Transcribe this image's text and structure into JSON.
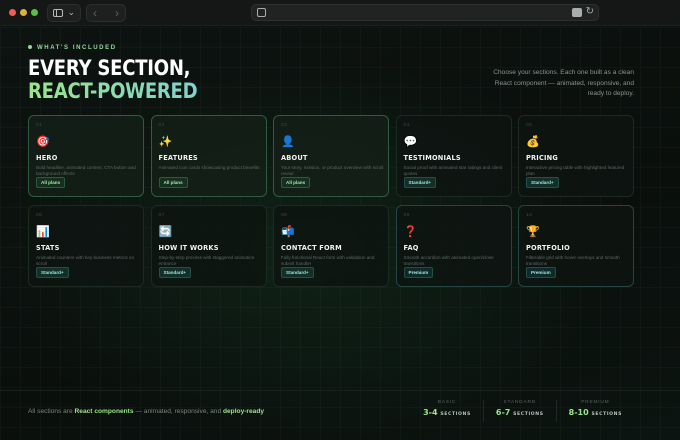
{
  "header": {
    "eyebrow": "WHAT'S INCLUDED",
    "title_line1": "EVERY SECTION,",
    "title_line2": "REACT-POWERED",
    "intro": "Choose your sections. Each one built as a clean React component — animated, responsive, and ready to deploy."
  },
  "sections": [
    {
      "num": "01",
      "icon": "🎯",
      "icon_name": "target-icon",
      "title": "HERO",
      "desc": "Bold headline, animated content, CTA button and background effects",
      "badge": "All plans",
      "tier": "free"
    },
    {
      "num": "02",
      "icon": "✨",
      "icon_name": "sparkles-icon",
      "title": "FEATURES",
      "desc": "Animated icon cards showcasing product benefits",
      "badge": "All plans",
      "tier": "free"
    },
    {
      "num": "03",
      "icon": "👤",
      "icon_name": "person-icon",
      "title": "ABOUT",
      "desc": "Your story, mission, or product overview with scroll reveal",
      "badge": "All plans",
      "tier": "free"
    },
    {
      "num": "04",
      "icon": "💬",
      "icon_name": "speech-bubble-icon",
      "title": "TESTIMONIALS",
      "desc": "Social proof with animated star ratings and client quotes",
      "badge": "Standard+",
      "tier": "std"
    },
    {
      "num": "05",
      "icon": "💰",
      "icon_name": "money-bag-icon",
      "title": "PRICING",
      "desc": "Interactive pricing table with highlighted featured plan",
      "badge": "Standard+",
      "tier": "std"
    },
    {
      "num": "06",
      "icon": "📊",
      "icon_name": "bar-chart-icon",
      "title": "STATS",
      "desc": "Animated counters with key business metrics on scroll",
      "badge": "Standard+",
      "tier": "std"
    },
    {
      "num": "07",
      "icon": "🔄",
      "icon_name": "cycle-icon",
      "title": "HOW IT WORKS",
      "desc": "Step-by-step process with staggered animation entrance",
      "badge": "Standard+",
      "tier": "std"
    },
    {
      "num": "08",
      "icon": "📬",
      "icon_name": "mailbox-icon",
      "title": "CONTACT FORM",
      "desc": "Fully functional React form with validation and submit handler",
      "badge": "Standard+",
      "tier": "std"
    },
    {
      "num": "09",
      "icon": "❓",
      "icon_name": "question-mark-icon",
      "title": "FAQ",
      "desc": "Smooth accordion with animated open/close transitions",
      "badge": "Premium",
      "tier": "prem"
    },
    {
      "num": "10",
      "icon": "🏆",
      "icon_name": "trophy-icon",
      "title": "PORTFOLIO",
      "desc": "Filterable grid with hover overlays and smooth transitions",
      "badge": "Premium",
      "tier": "prem"
    }
  ],
  "footer": {
    "prefix": "All sections are ",
    "highlight1": "React components",
    "middle": " — animated, responsive, and ",
    "highlight2": "deploy-ready",
    "tiers": [
      {
        "name": "BASIC",
        "value": "3-4",
        "unit": "SECTIONS"
      },
      {
        "name": "STANDARD",
        "value": "6-7",
        "unit": "SECTIONS"
      },
      {
        "name": "PREMIUM",
        "value": "8-10",
        "unit": "SECTIONS"
      }
    ]
  },
  "colors": {
    "accent_green": "#9be58a",
    "accent_teal": "#7fd3cf",
    "background": "#0b100e"
  }
}
